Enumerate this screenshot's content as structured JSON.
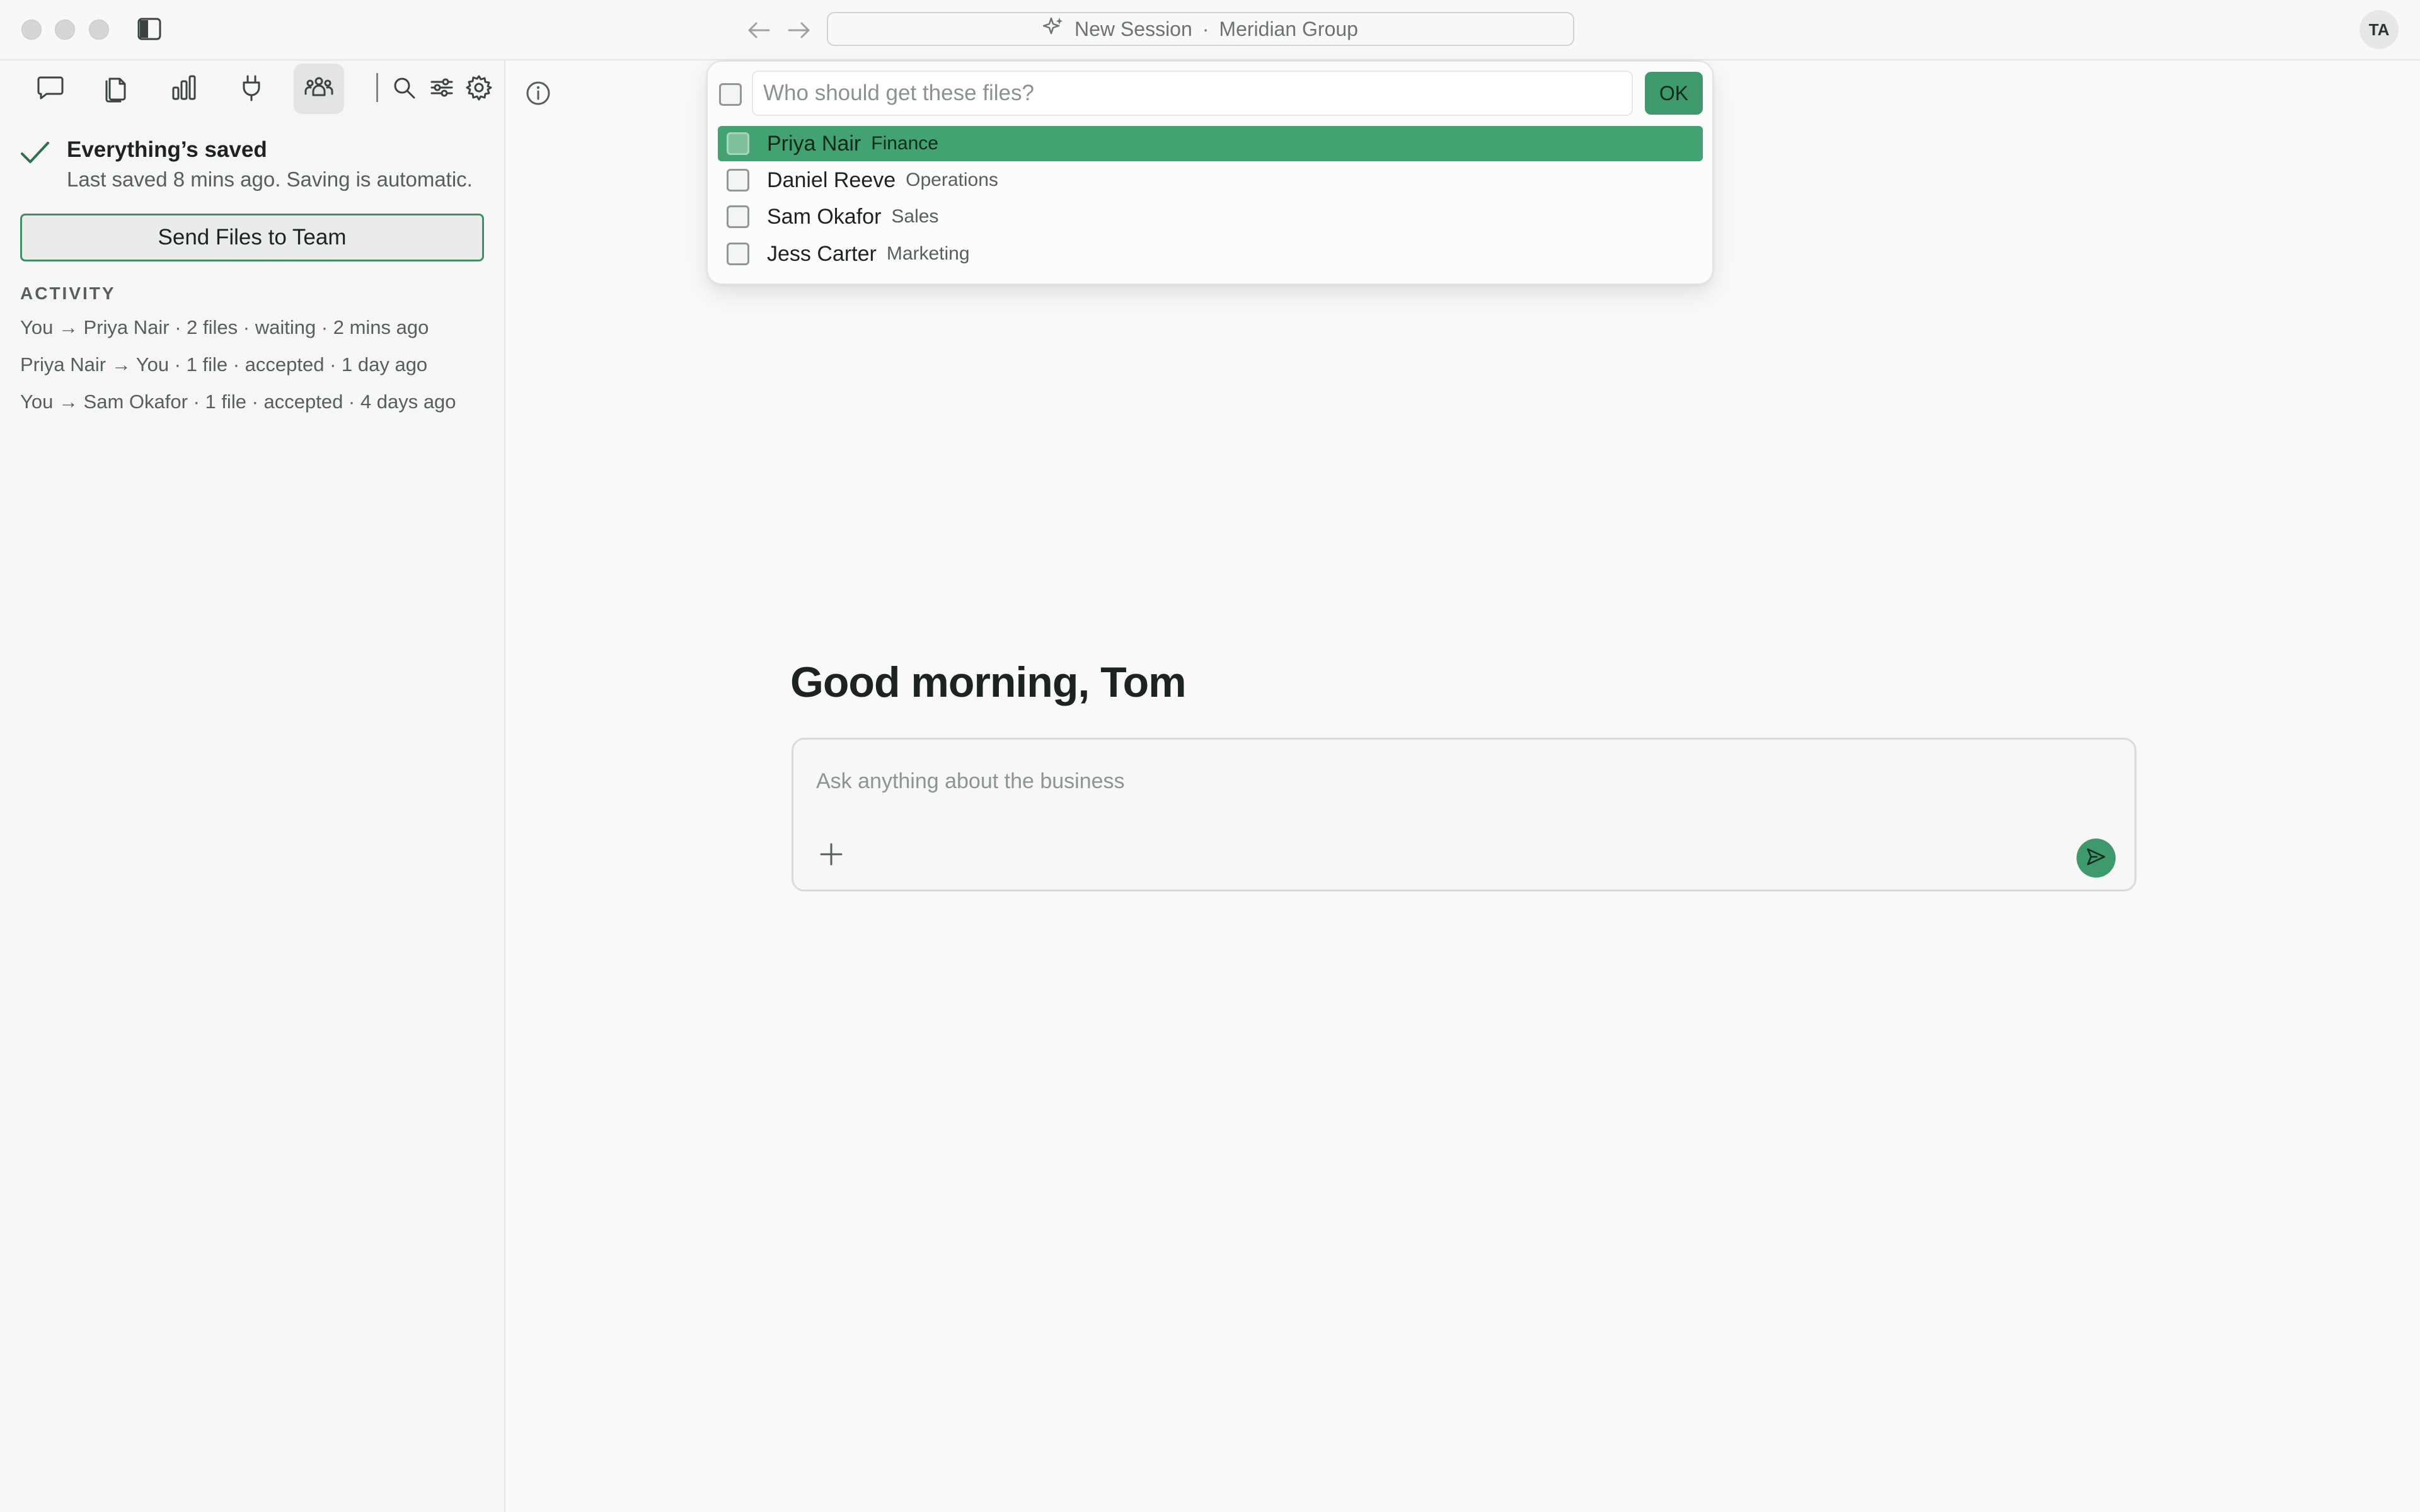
{
  "window": {
    "title": "New Session",
    "workspace": "Meridian Group",
    "title_separator": "·",
    "avatar_initials": "TA"
  },
  "sidebar": {
    "tools": [
      {
        "name": "chat-icon"
      },
      {
        "name": "documents-icon"
      },
      {
        "name": "bar-chart-icon"
      },
      {
        "name": "plug-icon"
      },
      {
        "name": "team-icon",
        "active": true
      }
    ],
    "utility_icons": [
      "search-icon",
      "sliders-icon",
      "gear-icon"
    ],
    "save_status": {
      "title": "Everything’s saved",
      "subtitle": "Last saved 8 mins ago. Saving is automatic."
    },
    "send_files_label": "Send Files to Team",
    "activity_heading": "ACTIVITY",
    "activity": [
      "You → Priya Nair · 2 files · waiting · 2 mins ago",
      "Priya Nair → You · 1 file · accepted · 1 day ago",
      "You → Sam Okafor · 1 file · accepted · 4 days ago"
    ]
  },
  "main": {
    "greeting": "Good morning, Tom",
    "composer_placeholder": "Ask anything about the business"
  },
  "recipient_picker": {
    "placeholder": "Who should get these files?",
    "ok_label": "OK",
    "options": [
      {
        "name": "Priya Nair",
        "dept": "Finance",
        "highlighted": true,
        "checked": false
      },
      {
        "name": "Daniel Reeve",
        "dept": "Operations",
        "highlighted": false,
        "checked": false
      },
      {
        "name": "Sam Okafor",
        "dept": "Sales",
        "highlighted": false,
        "checked": false
      },
      {
        "name": "Jess Carter",
        "dept": "Marketing",
        "highlighted": false,
        "checked": false
      }
    ]
  },
  "colors": {
    "accent": "#3e9a6c",
    "highlight": "#43a271",
    "background": "#f8f9f8"
  }
}
